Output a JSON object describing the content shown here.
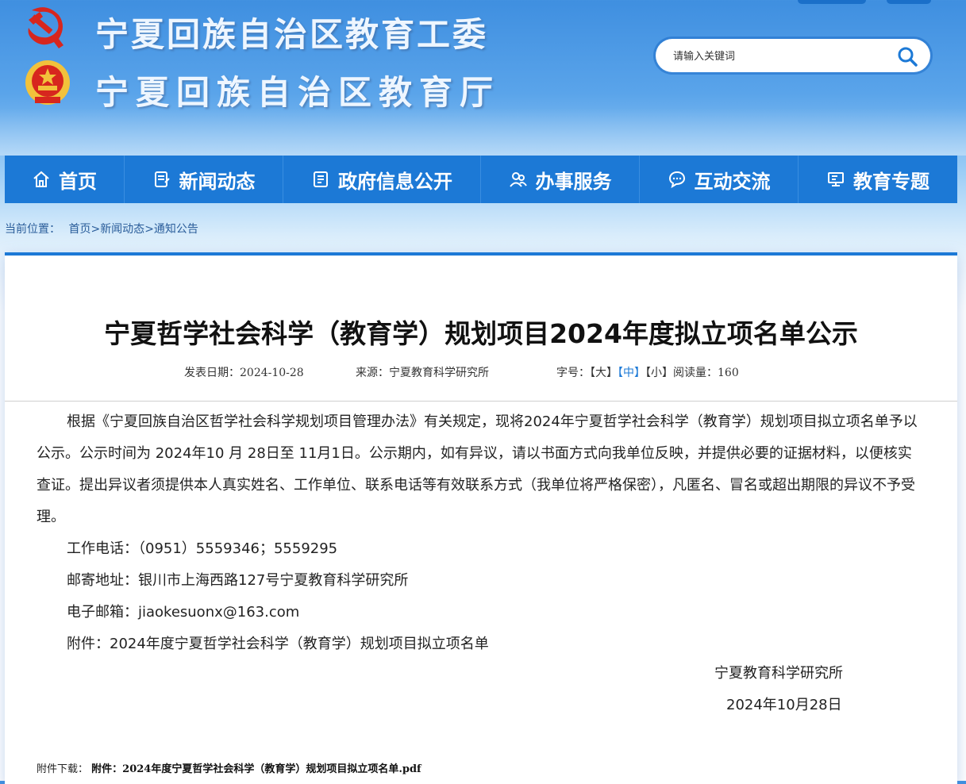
{
  "header": {
    "title_committee": "宁夏回族自治区教育工委",
    "title_department": "宁夏回族自治区教育厅"
  },
  "search": {
    "placeholder": "请输入关键词"
  },
  "nav": {
    "items": [
      {
        "label": "首页",
        "icon": "home-icon"
      },
      {
        "label": "新闻动态",
        "icon": "news-icon"
      },
      {
        "label": "政府信息公开",
        "icon": "document-icon"
      },
      {
        "label": "办事服务",
        "icon": "service-icon"
      },
      {
        "label": "互动交流",
        "icon": "chat-icon"
      },
      {
        "label": "教育专题",
        "icon": "monitor-icon"
      }
    ]
  },
  "breadcrumb": {
    "prefix": "当前位置：",
    "home": "首页",
    "sep1": ">",
    "news": "新闻动态",
    "sep2": ">",
    "notice": "通知公告"
  },
  "article": {
    "title": "宁夏哲学社会科学（教育学）规划项目2024年度拟立项名单公示",
    "date_label": "发表日期：",
    "date": "2024-10-28",
    "source_label": "来源：",
    "source": "宁夏教育科学研究所",
    "font_label": "字号：",
    "size_large": "【大】",
    "size_medium": "【中】",
    "size_small": "【小】",
    "views_label": "阅读量：",
    "views": "160",
    "paragraph": "根据《宁夏回族自治区哲学社会科学规划项目管理办法》有关规定，现将2024年宁夏哲学社会科学（教育学）规划项目拟立项名单予以公示。公示时间为 2024年10 月 28日至 11月1日。公示期内，如有异议，请以书面方式向我单位反映，并提供必要的证据材料，以便核实查证。提出异议者须提供本人真实姓名、工作单位、联系电话等有效联系方式（我单位将严格保密），凡匿名、冒名或超出期限的异议不予受理。",
    "phone": "工作电话：（0951）5559346；5559295",
    "address": "邮寄地址：银川市上海西路127号宁夏教育科学研究所",
    "email": "电子邮箱：jiaokesuonx@163.com",
    "attachment_line": "附件：2024年度宁夏哲学社会科学（教育学）规划项目拟立项名单",
    "sign_org": "宁夏教育科学研究所",
    "sign_date": "2024年10月28日",
    "download_label": "附件下载：",
    "download_link": "附件：2024年度宁夏哲学社会科学（教育学）规划项目拟立项名单.pdf"
  },
  "colors": {
    "nav_blue": "#1c79d6",
    "emblem_red": "#d7261e",
    "emblem_gold": "#f2c23b"
  }
}
